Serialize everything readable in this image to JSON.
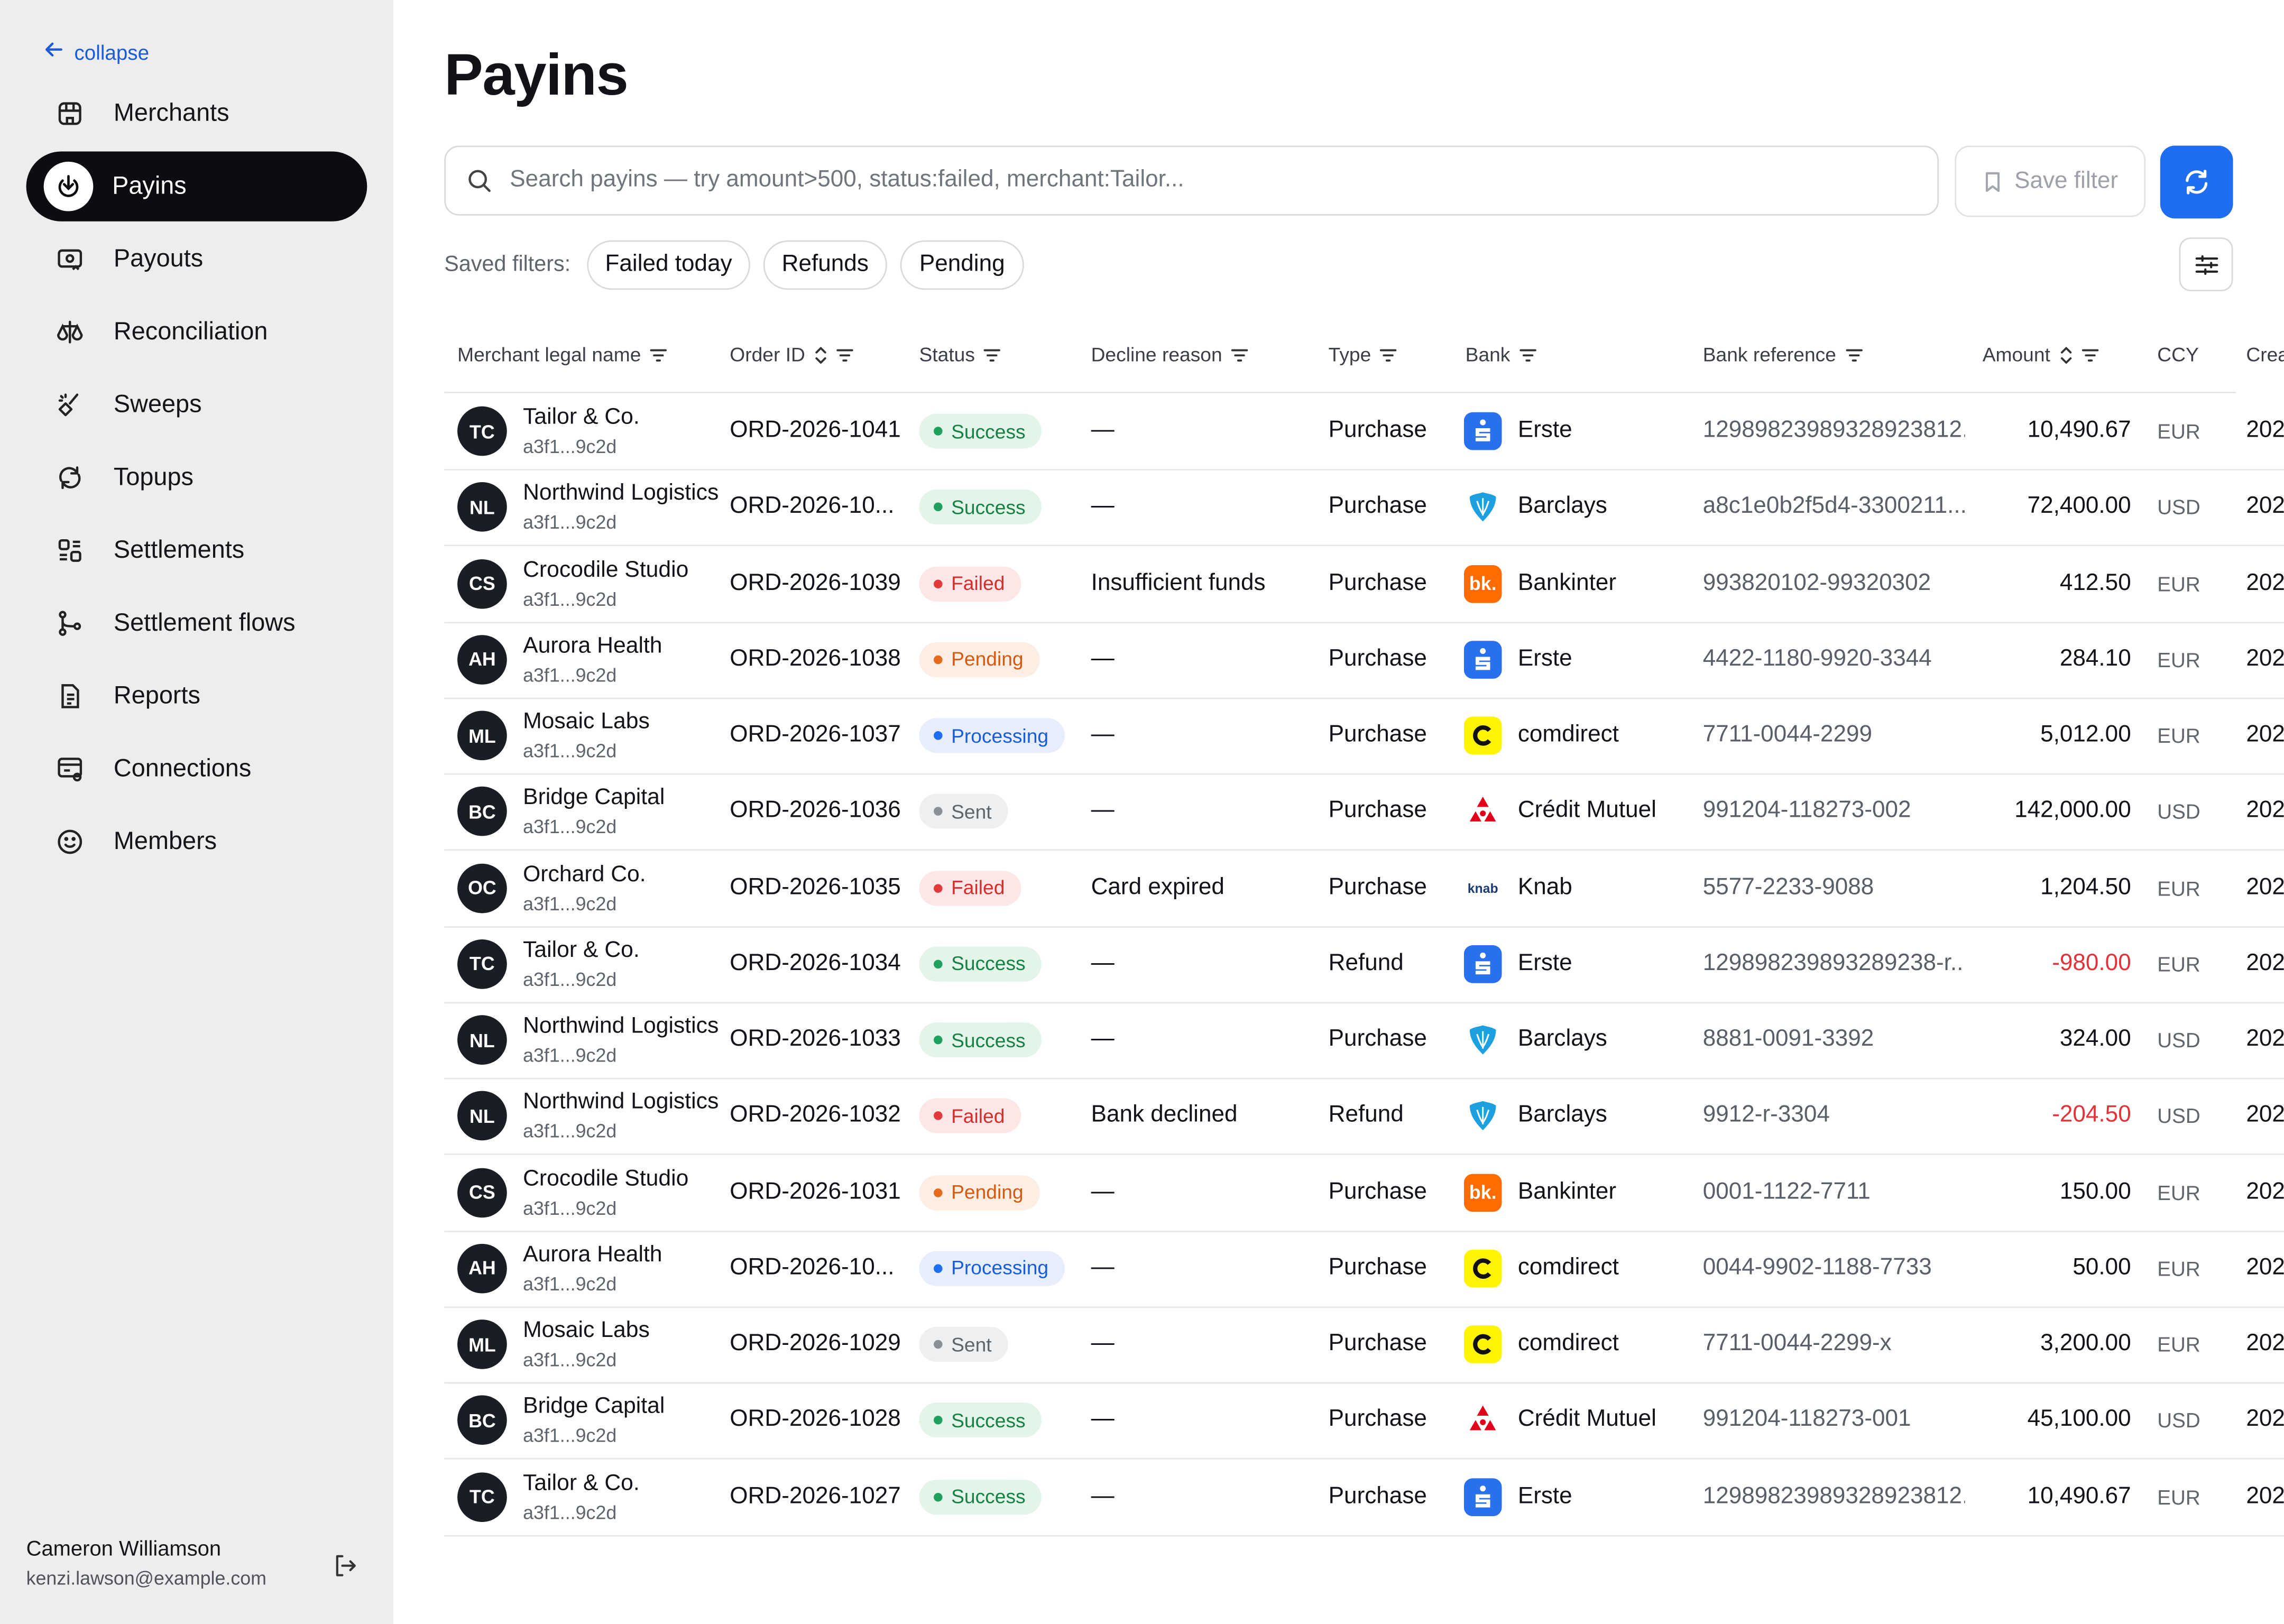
{
  "sidebar": {
    "collapse_label": "collapse",
    "items": [
      {
        "label": "Merchants",
        "icon": "storefront-icon",
        "active": false
      },
      {
        "label": "Payins",
        "icon": "download-circle-icon",
        "active": true
      },
      {
        "label": "Payouts",
        "icon": "payout-icon",
        "active": false
      },
      {
        "label": "Reconciliation",
        "icon": "scale-icon",
        "active": false
      },
      {
        "label": "Sweeps",
        "icon": "broom-icon",
        "active": false
      },
      {
        "label": "Topups",
        "icon": "topup-icon",
        "active": false
      },
      {
        "label": "Settlements",
        "icon": "settlements-icon",
        "active": false
      },
      {
        "label": "Settlement flows",
        "icon": "flow-icon",
        "active": false
      },
      {
        "label": "Reports",
        "icon": "report-icon",
        "active": false
      },
      {
        "label": "Connections",
        "icon": "connections-icon",
        "active": false
      },
      {
        "label": "Members",
        "icon": "smile-icon",
        "active": false
      }
    ],
    "user": {
      "name": "Cameron Williamson",
      "email": "kenzi.lawson@example.com"
    }
  },
  "page": {
    "title": "Payins",
    "search_placeholder": "Search payins — try amount>500, status:failed, merchant:Tailor...",
    "save_filter_label": "Save filter",
    "saved_filters_label": "Saved filters:",
    "saved_filters": [
      "Failed today",
      "Refunds",
      "Pending"
    ]
  },
  "table": {
    "headers": {
      "merchant": "Merchant legal name",
      "order_id": "Order ID",
      "status": "Status",
      "decline": "Decline reason",
      "type": "Type",
      "bank": "Bank",
      "bank_ref": "Bank reference",
      "amount": "Amount",
      "ccy": "CCY",
      "created": "Crea"
    },
    "rows": [
      {
        "initials": "TC",
        "merchant": "Tailor & Co.",
        "merchant_id": "a3f1...9c2d",
        "order_id": "ORD-2026-1041",
        "status": "Success",
        "status_key": "success",
        "decline": "—",
        "type": "Purchase",
        "bank": "Erste",
        "bank_logo": "erste",
        "bank_ref": "12989823989328923812...",
        "amount": "10,490.67",
        "negative": false,
        "ccy": "EUR",
        "created": "202"
      },
      {
        "initials": "NL",
        "merchant": "Northwind Logistics",
        "merchant_id": "a3f1...9c2d",
        "order_id": "ORD-2026-10...",
        "status": "Success",
        "status_key": "success",
        "decline": "—",
        "type": "Purchase",
        "bank": "Barclays",
        "bank_logo": "barclays",
        "bank_ref": "a8c1e0b2f5d4-3300211...",
        "amount": "72,400.00",
        "negative": false,
        "ccy": "USD",
        "created": "202"
      },
      {
        "initials": "CS",
        "merchant": "Crocodile Studio",
        "merchant_id": "a3f1...9c2d",
        "order_id": "ORD-2026-1039",
        "status": "Failed",
        "status_key": "failed",
        "decline": "Insufficient funds",
        "type": "Purchase",
        "bank": "Bankinter",
        "bank_logo": "bankinter",
        "bank_ref": "993820102-99320302",
        "amount": "412.50",
        "negative": false,
        "ccy": "EUR",
        "created": "202"
      },
      {
        "initials": "AH",
        "merchant": "Aurora Health",
        "merchant_id": "a3f1...9c2d",
        "order_id": "ORD-2026-1038",
        "status": "Pending",
        "status_key": "pending",
        "decline": "—",
        "type": "Purchase",
        "bank": "Erste",
        "bank_logo": "erste",
        "bank_ref": "4422-1180-9920-3344",
        "amount": "284.10",
        "negative": false,
        "ccy": "EUR",
        "created": "202"
      },
      {
        "initials": "ML",
        "merchant": "Mosaic Labs",
        "merchant_id": "a3f1...9c2d",
        "order_id": "ORD-2026-1037",
        "status": "Processing",
        "status_key": "processing",
        "decline": "—",
        "type": "Purchase",
        "bank": "comdirect",
        "bank_logo": "comdirect",
        "bank_ref": "7711-0044-2299",
        "amount": "5,012.00",
        "negative": false,
        "ccy": "EUR",
        "created": "202"
      },
      {
        "initials": "BC",
        "merchant": "Bridge Capital",
        "merchant_id": "a3f1...9c2d",
        "order_id": "ORD-2026-1036",
        "status": "Sent",
        "status_key": "sent",
        "decline": "—",
        "type": "Purchase",
        "bank": "Crédit Mutuel",
        "bank_logo": "creditmutuel",
        "bank_ref": "991204-118273-002",
        "amount": "142,000.00",
        "negative": false,
        "ccy": "USD",
        "created": "202"
      },
      {
        "initials": "OC",
        "merchant": "Orchard Co.",
        "merchant_id": "a3f1...9c2d",
        "order_id": "ORD-2026-1035",
        "status": "Failed",
        "status_key": "failed",
        "decline": "Card expired",
        "type": "Purchase",
        "bank": "Knab",
        "bank_logo": "knab",
        "bank_ref": "5577-2233-9088",
        "amount": "1,204.50",
        "negative": false,
        "ccy": "EUR",
        "created": "202"
      },
      {
        "initials": "TC",
        "merchant": "Tailor & Co.",
        "merchant_id": "a3f1...9c2d",
        "order_id": "ORD-2026-1034",
        "status": "Success",
        "status_key": "success",
        "decline": "—",
        "type": "Refund",
        "bank": "Erste",
        "bank_logo": "erste",
        "bank_ref": "129898239893289238-r...",
        "amount": "-980.00",
        "negative": true,
        "ccy": "EUR",
        "created": "202"
      },
      {
        "initials": "NL",
        "merchant": "Northwind Logistics",
        "merchant_id": "a3f1...9c2d",
        "order_id": "ORD-2026-1033",
        "status": "Success",
        "status_key": "success",
        "decline": "—",
        "type": "Purchase",
        "bank": "Barclays",
        "bank_logo": "barclays",
        "bank_ref": "8881-0091-3392",
        "amount": "324.00",
        "negative": false,
        "ccy": "USD",
        "created": "202"
      },
      {
        "initials": "NL",
        "merchant": "Northwind Logistics",
        "merchant_id": "a3f1...9c2d",
        "order_id": "ORD-2026-1032",
        "status": "Failed",
        "status_key": "failed",
        "decline": "Bank declined",
        "type": "Refund",
        "bank": "Barclays",
        "bank_logo": "barclays",
        "bank_ref": "9912-r-3304",
        "amount": "-204.50",
        "negative": true,
        "ccy": "USD",
        "created": "202"
      },
      {
        "initials": "CS",
        "merchant": "Crocodile Studio",
        "merchant_id": "a3f1...9c2d",
        "order_id": "ORD-2026-1031",
        "status": "Pending",
        "status_key": "pending",
        "decline": "—",
        "type": "Purchase",
        "bank": "Bankinter",
        "bank_logo": "bankinter",
        "bank_ref": "0001-1122-7711",
        "amount": "150.00",
        "negative": false,
        "ccy": "EUR",
        "created": "202"
      },
      {
        "initials": "AH",
        "merchant": "Aurora Health",
        "merchant_id": "a3f1...9c2d",
        "order_id": "ORD-2026-10...",
        "status": "Processing",
        "status_key": "processing",
        "decline": "—",
        "type": "Purchase",
        "bank": "comdirect",
        "bank_logo": "comdirect",
        "bank_ref": "0044-9902-1188-7733",
        "amount": "50.00",
        "negative": false,
        "ccy": "EUR",
        "created": "202"
      },
      {
        "initials": "ML",
        "merchant": "Mosaic Labs",
        "merchant_id": "a3f1...9c2d",
        "order_id": "ORD-2026-1029",
        "status": "Sent",
        "status_key": "sent",
        "decline": "—",
        "type": "Purchase",
        "bank": "comdirect",
        "bank_logo": "comdirect",
        "bank_ref": "7711-0044-2299-x",
        "amount": "3,200.00",
        "negative": false,
        "ccy": "EUR",
        "created": "202"
      },
      {
        "initials": "BC",
        "merchant": "Bridge Capital",
        "merchant_id": "a3f1...9c2d",
        "order_id": "ORD-2026-1028",
        "status": "Success",
        "status_key": "success",
        "decline": "—",
        "type": "Purchase",
        "bank": "Crédit Mutuel",
        "bank_logo": "creditmutuel",
        "bank_ref": "991204-118273-001",
        "amount": "45,100.00",
        "negative": false,
        "ccy": "USD",
        "created": "202"
      },
      {
        "initials": "TC",
        "merchant": "Tailor & Co.",
        "merchant_id": "a3f1...9c2d",
        "order_id": "ORD-2026-1027",
        "status": "Success",
        "status_key": "success",
        "decline": "—",
        "type": "Purchase",
        "bank": "Erste",
        "bank_logo": "erste",
        "bank_ref": "12989823989328923812...",
        "amount": "10,490.67",
        "negative": false,
        "ccy": "EUR",
        "created": "202"
      }
    ]
  },
  "colors": {
    "accent": "#1f6ef2",
    "sidebar_bg": "#ededee",
    "active_nav": "#0c0d10",
    "negative_amount": "#e0343a"
  }
}
